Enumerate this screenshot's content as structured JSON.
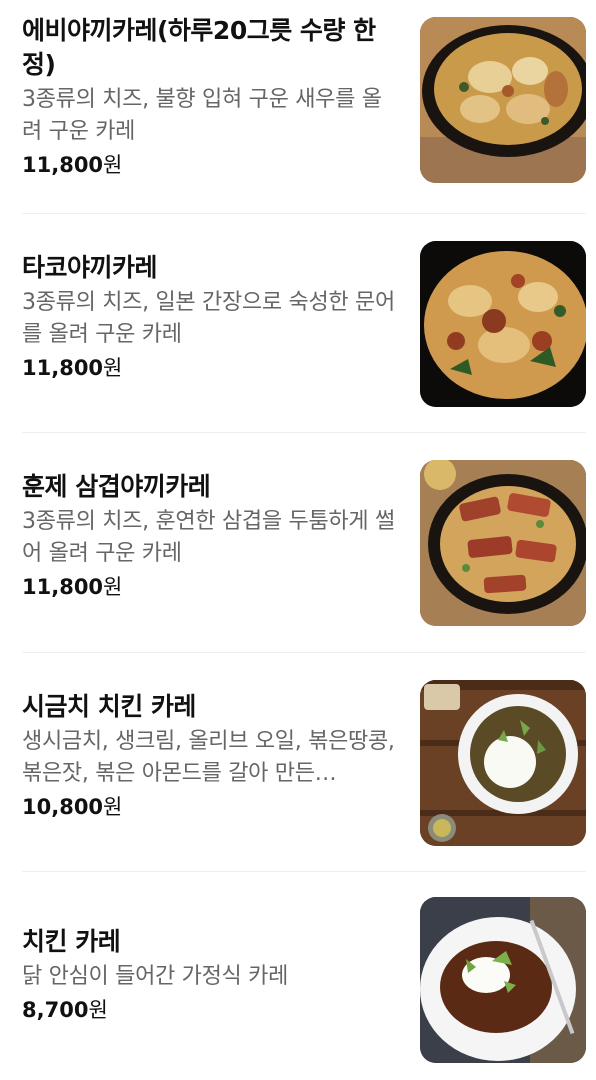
{
  "menu": {
    "items": [
      {
        "name": "에비야끼카레(하루20그릇 수량 한정)",
        "description": "3종류의 치즈, 불향 입혀 구운 새우를 올려 구운 카레",
        "price": "11,800",
        "currency": "원",
        "image": "shrimp-cheese-curry-photo"
      },
      {
        "name": "타코야끼카레",
        "description": "3종류의 치즈, 일본 간장으로 숙성한 문어를 올려 구운 카레",
        "price": "11,800",
        "currency": "원",
        "image": "octopus-cheese-curry-photo"
      },
      {
        "name": "훈제 삼겹야끼카레",
        "description": "3종류의 치즈, 훈연한 삼겹을 두툼하게 썰어 올려 구운 카레",
        "price": "11,800",
        "currency": "원",
        "image": "smoked-pork-belly-curry-photo"
      },
      {
        "name": "시금치 치킨 카레",
        "description": "생시금치, 생크림, 올리브 오일, 볶은땅콩, 볶은잣, 볶은 아몬드를 갈아 만든…",
        "price": "10,800",
        "currency": "원",
        "image": "spinach-chicken-curry-photo"
      },
      {
        "name": "치킨 카레",
        "description": "닭 안심이 들어간 가정식 카레",
        "price": "8,700",
        "currency": "원",
        "image": "chicken-curry-photo"
      }
    ]
  }
}
